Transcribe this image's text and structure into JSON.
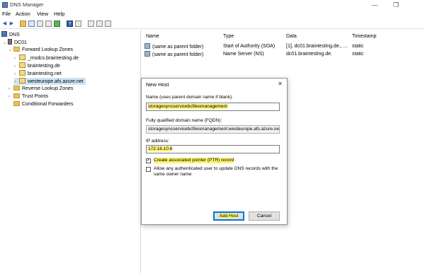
{
  "window": {
    "title": "DNS Manager",
    "minimize": "—",
    "restore": "❐"
  },
  "menu": [
    "File",
    "Action",
    "View",
    "Help"
  ],
  "tree": {
    "root": "DNS",
    "server": "DC01",
    "forward_zones": "Forward Lookup Zones",
    "zones": [
      "_msdcs.braintesting.de",
      "braintesting.de",
      "braintesting.net",
      "westeurope.afs.azure.net"
    ],
    "reverse_zones": "Reverse Lookup Zones",
    "trust_points": "Trust Points",
    "conditional_forwarders": "Conditional Forwarders"
  },
  "list": {
    "columns": [
      "Name",
      "Type",
      "Data",
      "Timestamp"
    ],
    "rows": [
      [
        "(same as parent folder)",
        "Start of Authority (SOA)",
        "[1], dc01.braintesting.de., ...",
        "static"
      ],
      [
        "(same as parent folder)",
        "Name Server (NS)",
        "dc01.braintesting.de.",
        "static"
      ]
    ]
  },
  "dialog": {
    "title": "New Host",
    "close": "✕",
    "name_label": "Name (uses parent domain name if blank):",
    "name_value": "storagesyncservicebcfilesmanagement",
    "fqdn_label": "Fully qualified domain name (FQDN):",
    "fqdn_value": "storagesyncservicebcfilesmanagement.westeurope.afs.azure.ne",
    "ip_label": "IP address:",
    "ip_value": "172.16.10.6",
    "ptr_label": "Create associated pointer (PTR) record",
    "ptr_checked": true,
    "allow_label": "Allow any authenticated user to update DNS records with the same owner name",
    "allow_checked": false,
    "add_button": "Add Host",
    "cancel_button": "Cancel"
  },
  "colors": {
    "highlight": "#fff36e",
    "selection": "#cce4f7",
    "accent": "#0078d7"
  }
}
